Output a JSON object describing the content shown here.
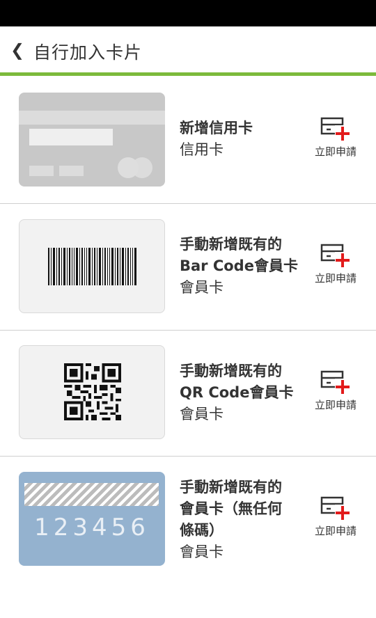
{
  "header": {
    "back_glyph": "❮",
    "title": "自行加入卡片"
  },
  "accent_color": "#7cba3b",
  "cards": [
    {
      "title_lines": [
        "新增信用卡"
      ],
      "subtitle": "信用卡",
      "action_label": "立即申請",
      "thumbnail": "credit-card-thumbnail"
    },
    {
      "title_lines": [
        "手動新增既有的",
        "Bar Code會員卡"
      ],
      "subtitle": "會員卡",
      "action_label": "立即申請",
      "thumbnail": "barcode-thumbnail"
    },
    {
      "title_lines": [
        "手動新增既有的",
        "QR Code會員卡"
      ],
      "subtitle": "會員卡",
      "action_label": "立即申請",
      "thumbnail": "qr-code-thumbnail"
    },
    {
      "title_lines": [
        "手動新增既有的",
        "會員卡（無任何",
        "條碼）"
      ],
      "subtitle": "會員卡",
      "action_label": "立即申請",
      "thumbnail": "member-card-thumbnail",
      "card_number": "123456"
    }
  ]
}
